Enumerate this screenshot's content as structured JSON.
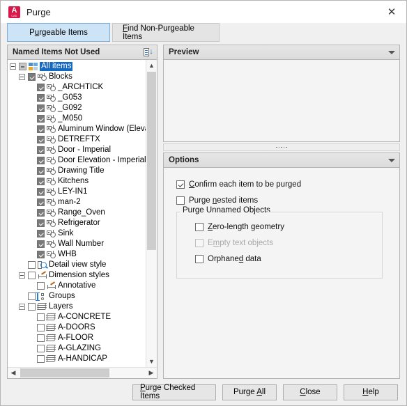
{
  "window": {
    "title": "Purge",
    "logo_icon": "autocad-logo-icon",
    "close_icon": "close-icon"
  },
  "tabs": [
    {
      "label": "Purgeable Items",
      "accel": "u",
      "active": true
    },
    {
      "label": "Find Non-Purgeable Items",
      "accel": "F",
      "active": false
    }
  ],
  "left_panel": {
    "header": "Named Items Not Used",
    "sort_icon": "sort-descending-icon",
    "tree": [
      {
        "label": "All items",
        "depth": 0,
        "check": "partial",
        "expander": "minus",
        "icon": "all-items-icon",
        "selected": true
      },
      {
        "label": "Blocks",
        "depth": 1,
        "check": "checked",
        "expander": "minus",
        "icon": "block-icon",
        "selected": false
      },
      {
        "label": "_ARCHTICK",
        "depth": 2,
        "check": "checked",
        "expander": "none",
        "icon": "block-icon",
        "selected": false
      },
      {
        "label": "_G053",
        "depth": 2,
        "check": "checked",
        "expander": "none",
        "icon": "block-icon",
        "selected": false
      },
      {
        "label": "_G092",
        "depth": 2,
        "check": "checked",
        "expander": "none",
        "icon": "block-icon",
        "selected": false
      },
      {
        "label": "_M050",
        "depth": 2,
        "check": "checked",
        "expander": "none",
        "icon": "block-icon",
        "selected": false
      },
      {
        "label": "Aluminum Window (Elevat",
        "depth": 2,
        "check": "checked",
        "expander": "none",
        "icon": "block-icon",
        "selected": false
      },
      {
        "label": "DETREFTX",
        "depth": 2,
        "check": "checked",
        "expander": "none",
        "icon": "block-icon",
        "selected": false
      },
      {
        "label": "Door - Imperial",
        "depth": 2,
        "check": "checked",
        "expander": "none",
        "icon": "block-icon",
        "selected": false
      },
      {
        "label": "Door Elevation - Imperial",
        "depth": 2,
        "check": "checked",
        "expander": "none",
        "icon": "block-icon",
        "selected": false
      },
      {
        "label": "Drawing Title",
        "depth": 2,
        "check": "checked",
        "expander": "none",
        "icon": "block-icon",
        "selected": false
      },
      {
        "label": "Kitchens",
        "depth": 2,
        "check": "checked",
        "expander": "none",
        "icon": "block-icon",
        "selected": false
      },
      {
        "label": "LEY-IN1",
        "depth": 2,
        "check": "checked",
        "expander": "none",
        "icon": "block-icon",
        "selected": false
      },
      {
        "label": "man-2",
        "depth": 2,
        "check": "checked",
        "expander": "none",
        "icon": "block-icon",
        "selected": false
      },
      {
        "label": "Range_Oven",
        "depth": 2,
        "check": "checked",
        "expander": "none",
        "icon": "block-icon",
        "selected": false
      },
      {
        "label": "Refrigerator",
        "depth": 2,
        "check": "checked",
        "expander": "none",
        "icon": "block-icon",
        "selected": false
      },
      {
        "label": "Sink",
        "depth": 2,
        "check": "checked",
        "expander": "none",
        "icon": "block-icon",
        "selected": false
      },
      {
        "label": "Wall Number",
        "depth": 2,
        "check": "checked",
        "expander": "none",
        "icon": "block-icon",
        "selected": false
      },
      {
        "label": "WHB",
        "depth": 2,
        "check": "checked",
        "expander": "none",
        "icon": "block-icon",
        "selected": false
      },
      {
        "label": "Detail view style",
        "depth": 1,
        "check": "unchecked",
        "expander": "none",
        "icon": "detail-view-style-icon",
        "selected": false
      },
      {
        "label": "Dimension styles",
        "depth": 1,
        "check": "unchecked",
        "expander": "minus",
        "icon": "dimension-style-icon",
        "selected": false
      },
      {
        "label": "Annotative",
        "depth": 2,
        "check": "unchecked",
        "expander": "none",
        "icon": "dimension-style-icon",
        "selected": false
      },
      {
        "label": "Groups",
        "depth": 1,
        "check": "unchecked",
        "expander": "none",
        "icon": "group-icon",
        "selected": false
      },
      {
        "label": "Layers",
        "depth": 1,
        "check": "unchecked",
        "expander": "minus",
        "icon": "layer-icon",
        "selected": false
      },
      {
        "label": "A-CONCRETE",
        "depth": 2,
        "check": "unchecked",
        "expander": "none",
        "icon": "layer-icon",
        "selected": false
      },
      {
        "label": "A-DOORS",
        "depth": 2,
        "check": "unchecked",
        "expander": "none",
        "icon": "layer-icon",
        "selected": false
      },
      {
        "label": "A-FLOOR",
        "depth": 2,
        "check": "unchecked",
        "expander": "none",
        "icon": "layer-icon",
        "selected": false
      },
      {
        "label": "A-GLAZING",
        "depth": 2,
        "check": "unchecked",
        "expander": "none",
        "icon": "layer-icon",
        "selected": false
      },
      {
        "label": "A-HANDICAP",
        "depth": 2,
        "check": "unchecked",
        "expander": "none",
        "icon": "layer-icon",
        "selected": false
      }
    ]
  },
  "preview": {
    "header": "Preview",
    "collapse_icon": "chevron-down-icon",
    "content": ""
  },
  "options": {
    "header": "Options",
    "collapse_icon": "chevron-down-icon",
    "confirm_each": {
      "label": "Confirm each item to be purged",
      "accel": "C",
      "checked": true,
      "enabled": true
    },
    "purge_nested": {
      "label": "Purge nested items",
      "accel": "n",
      "checked": false,
      "enabled": true
    },
    "unnamed_group_title": "Purge Unnamed Objects",
    "unnamed": [
      {
        "label": "Zero-length geometry",
        "accel": "Z",
        "checked": false,
        "enabled": true
      },
      {
        "label": "Empty text objects",
        "accel": "m",
        "checked": false,
        "enabled": false
      },
      {
        "label": "Orphaned data",
        "accel": "d",
        "checked": false,
        "enabled": true
      }
    ]
  },
  "footer": {
    "buttons": [
      {
        "label": "Purge Checked Items",
        "accel": "P"
      },
      {
        "label": "Purge All",
        "accel": "A"
      },
      {
        "label": "Close",
        "accel": "C"
      },
      {
        "label": "Help",
        "accel": "H"
      }
    ]
  }
}
